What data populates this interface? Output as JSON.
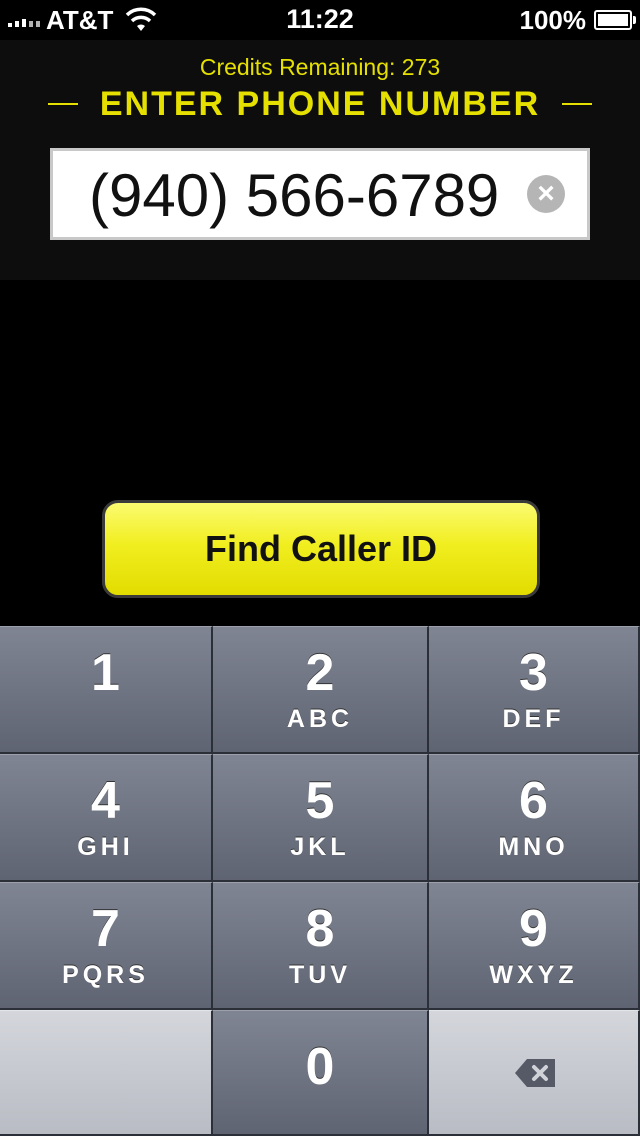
{
  "status_bar": {
    "carrier": "AT&T",
    "time": "11:22",
    "battery": "100%",
    "battery_level": 1.0
  },
  "header": {
    "credits": "Credits Remaining: 273",
    "title": "ENTER PHONE NUMBER"
  },
  "phone_input": {
    "value": "(940) 566-6789",
    "clear_icon": "clear-icon"
  },
  "find_button": {
    "label": "Find Caller ID"
  },
  "keypad": {
    "keys": [
      {
        "digit": "1",
        "letters": ""
      },
      {
        "digit": "2",
        "letters": "ABC"
      },
      {
        "digit": "3",
        "letters": "DEF"
      },
      {
        "digit": "4",
        "letters": "GHI"
      },
      {
        "digit": "5",
        "letters": "JKL"
      },
      {
        "digit": "6",
        "letters": "MNO"
      },
      {
        "digit": "7",
        "letters": "PQRS"
      },
      {
        "digit": "8",
        "letters": "TUV"
      },
      {
        "digit": "9",
        "letters": "WXYZ"
      },
      {
        "digit": "0",
        "letters": ""
      }
    ],
    "backspace_icon": "backspace-icon"
  },
  "colors": {
    "accent": "#e5e000",
    "button": "#f1ee20",
    "keypad": "#6b707d"
  }
}
